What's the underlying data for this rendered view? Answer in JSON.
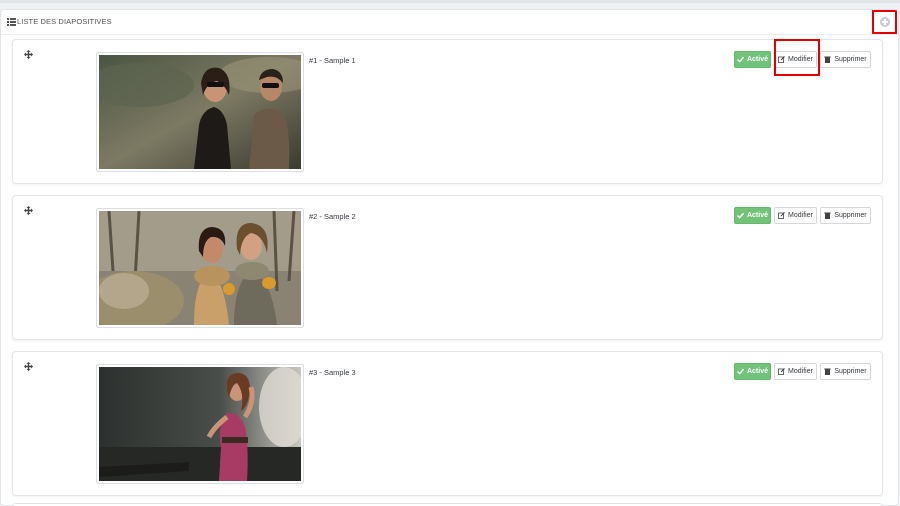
{
  "panel": {
    "title": "LISTE DES DIAPOSITIVES",
    "title_icon": "list-icon",
    "add_icon": "plus-circle-icon"
  },
  "slides": [
    {
      "title": "#1 - Sample 1",
      "status_label": "Activé",
      "edit_label": "Modifier",
      "delete_label": "Supprimer",
      "image": "couple-in-sunglasses-photo"
    },
    {
      "title": "#2 - Sample 2",
      "status_label": "Activé",
      "edit_label": "Modifier",
      "delete_label": "Supprimer",
      "image": "two-women-in-scarves-photo"
    },
    {
      "title": "#3 - Sample 3",
      "status_label": "Activé",
      "edit_label": "Modifier",
      "delete_label": "Supprimer",
      "image": "woman-in-pink-dress-photo"
    }
  ],
  "colors": {
    "active_green": "#72c279",
    "highlight_red": "#e30000"
  }
}
